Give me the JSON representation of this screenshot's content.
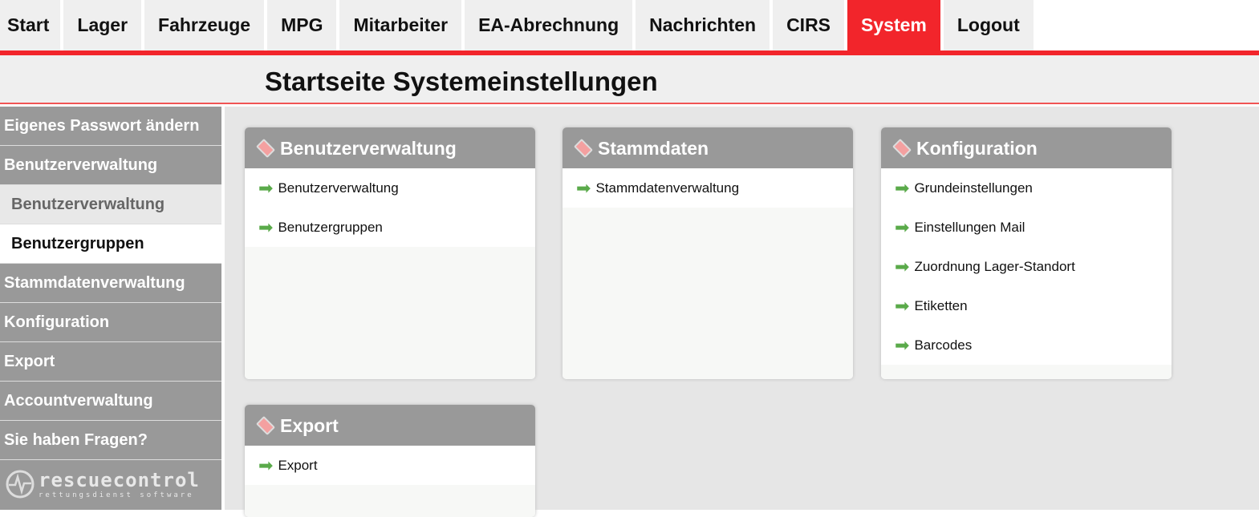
{
  "nav": {
    "tabs": [
      "Start",
      "Lager",
      "Fahrzeuge",
      "MPG",
      "Mitarbeiter",
      "EA-Abrechnung",
      "Nachrichten",
      "CIRS",
      "System",
      "Logout"
    ],
    "active": "System"
  },
  "header": {
    "title": "Startseite Systemeinstellungen"
  },
  "sidebar": {
    "items": [
      "Eigenes Passwort ändern",
      "Benutzerverwaltung",
      "Benutzerverwaltung",
      "Benutzergruppen",
      "Stammdatenverwaltung",
      "Konfiguration",
      "Export",
      "Accountverwaltung",
      "Sie haben Fragen?"
    ],
    "logo": {
      "name": "rescuecontrol",
      "tagline": "rettungsdienst software"
    }
  },
  "cards": [
    {
      "title": "Benutzerverwaltung",
      "links": [
        "Benutzerverwaltung",
        "Benutzergruppen"
      ]
    },
    {
      "title": "Stammdaten",
      "links": [
        "Stammdatenverwaltung"
      ]
    },
    {
      "title": "Konfiguration",
      "links": [
        "Grundeinstellungen",
        "Einstellungen Mail",
        "Zuordnung Lager-Standort",
        "Etiketten",
        "Barcodes"
      ]
    },
    {
      "title": "Export",
      "links": [
        "Export"
      ]
    }
  ],
  "colors": {
    "accent": "#f2252b",
    "arrow": "#5aaa4a"
  }
}
